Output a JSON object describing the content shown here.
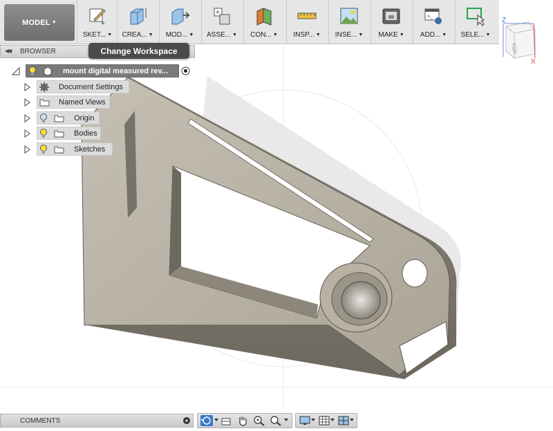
{
  "toolbar": {
    "workspace": "MODEL",
    "groups": [
      {
        "label": "SKET...",
        "icon": "sketch-icon"
      },
      {
        "label": "CREA...",
        "icon": "create-icon"
      },
      {
        "label": "MOD...",
        "icon": "modify-icon"
      },
      {
        "label": "ASSE...",
        "icon": "assemble-icon"
      },
      {
        "label": "CON...",
        "icon": "construct-icon"
      },
      {
        "label": "INSP...",
        "icon": "inspect-icon"
      },
      {
        "label": "INSE...",
        "icon": "insert-icon"
      },
      {
        "label": "MAKE",
        "icon": "make-icon"
      },
      {
        "label": "ADD...",
        "icon": "addins-icon"
      },
      {
        "label": "SELE...",
        "icon": "select-icon"
      }
    ]
  },
  "tooltip": "Change Workspace",
  "view_cube": {
    "face": "TOP",
    "axis_z": "Z",
    "axis_x": "X"
  },
  "browser": {
    "title": "BROWSER",
    "root": "mount digital measured rev...",
    "items": [
      {
        "label": "Document Settings",
        "icon": "gear-icon"
      },
      {
        "label": "Named Views",
        "icon": "folder-icon"
      },
      {
        "label": "Origin",
        "icon": "folder-icon"
      },
      {
        "label": "Bodies",
        "icon": "folder-icon"
      },
      {
        "label": "Sketches",
        "icon": "folder-icon"
      }
    ]
  },
  "comments": {
    "label": "COMMENTS"
  },
  "colors": {
    "accent": "#2a6fc9",
    "part": "#bcb5a8",
    "toolbar": "#e6e6e6"
  }
}
